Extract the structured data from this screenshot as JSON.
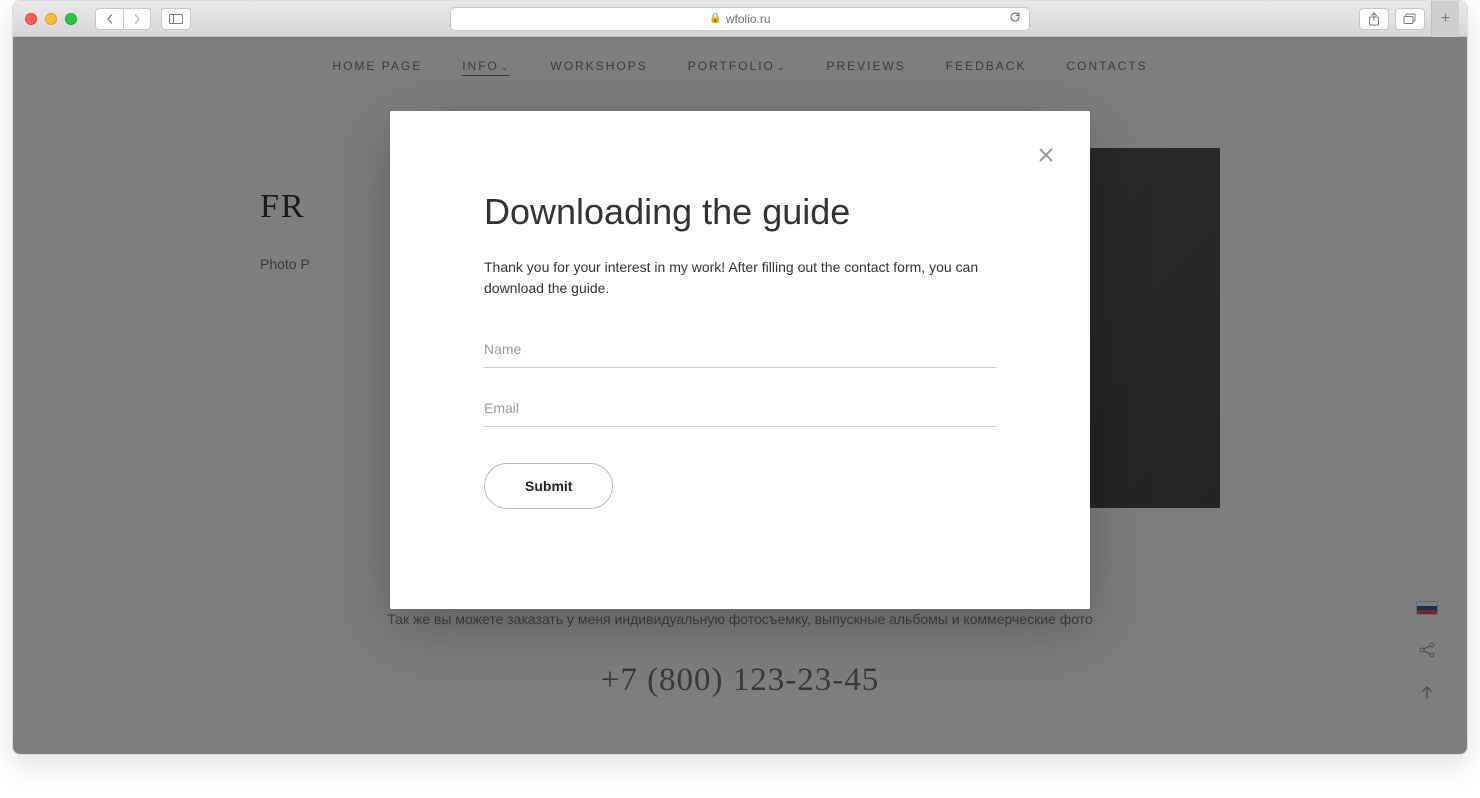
{
  "browser": {
    "url": "wfolio.ru"
  },
  "nav": {
    "items": [
      {
        "label": "HOME PAGE"
      },
      {
        "label": "INFO",
        "dropdown": true,
        "active": true
      },
      {
        "label": "WORKSHOPS"
      },
      {
        "label": "PORTFOLIO",
        "dropdown": true
      },
      {
        "label": "PREVIEWS"
      },
      {
        "label": "FEEDBACK"
      },
      {
        "label": "CONTACTS"
      }
    ]
  },
  "hero": {
    "title_part1": "FR",
    "subtitle_part1": "Photo P"
  },
  "footer": {
    "text": "Так же вы можете заказать у меня индивидуальную фотосъемку, выпускные альбомы и коммерческие фото",
    "phone": "+7 (800) 123-23-45"
  },
  "modal": {
    "title": "Downloading the guide",
    "description": "Thank you for your interest in my work! After filling out the contact form, you can download the guide.",
    "name_placeholder": "Name",
    "email_placeholder": "Email",
    "submit_label": "Submit"
  }
}
